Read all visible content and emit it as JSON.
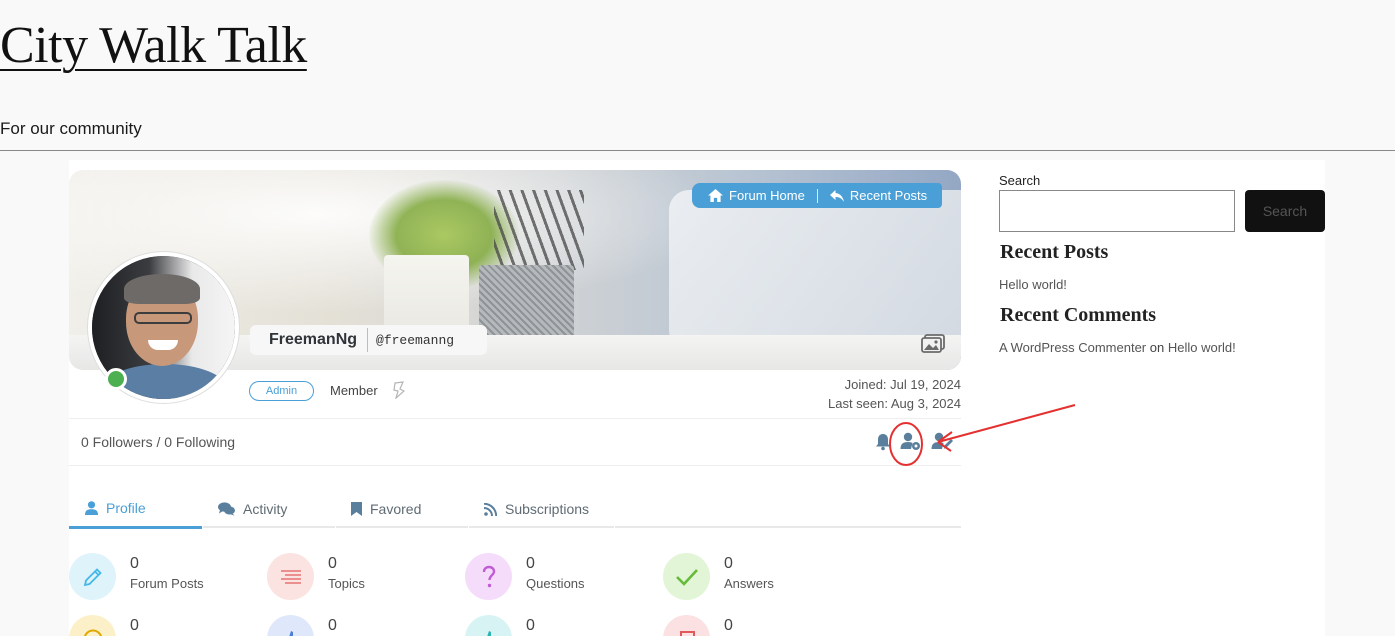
{
  "site": {
    "title": "City Walk Talk",
    "tagline": "For our community"
  },
  "profile": {
    "nav": {
      "forum_home": "Forum Home",
      "recent_posts": "Recent Posts"
    },
    "display_name": "FreemanNg",
    "username": "@freemanng",
    "role_badge": "Admin",
    "rank": "Member",
    "joined": "Joined: Jul 19, 2024",
    "last_seen": "Last seen: Aug 3, 2024",
    "online": true,
    "follow_text": "0 Followers / 0 Following",
    "action_icons": [
      "bell-icon",
      "user-settings-icon",
      "user-edit-icon"
    ],
    "tabs": [
      {
        "label": "Profile",
        "icon": "user-icon",
        "active": true
      },
      {
        "label": "Activity",
        "icon": "comments-icon",
        "active": false
      },
      {
        "label": "Favored",
        "icon": "bookmark-icon",
        "active": false
      },
      {
        "label": "Subscriptions",
        "icon": "rss-icon",
        "active": false
      }
    ],
    "stats": [
      {
        "value": "0",
        "label": "Forum Posts",
        "icon": "pencil-icon",
        "color": "#45b8e8",
        "bg": "#dff3fb"
      },
      {
        "value": "0",
        "label": "Topics",
        "icon": "list-icon",
        "color": "#e57373",
        "bg": "#fbe3e1"
      },
      {
        "value": "0",
        "label": "Questions",
        "icon": "question-icon",
        "color": "#c05cd6",
        "bg": "#f5dcfb"
      },
      {
        "value": "0",
        "label": "Answers",
        "icon": "check-icon",
        "color": "#66bb3a",
        "bg": "#e2f5d6"
      }
    ],
    "stats_row2": [
      {
        "value": "0",
        "icon": "comment-icon",
        "color": "#e0a800",
        "bg": "#fbf0c8"
      },
      {
        "value": "0",
        "icon": "thumbs-up-icon",
        "color": "#4a7fd6",
        "bg": "#dfe8fb"
      },
      {
        "value": "0",
        "icon": "thumbs-up-icon",
        "color": "#2bb3b3",
        "bg": "#d8f3f3"
      },
      {
        "value": "0",
        "icon": "flag-icon",
        "color": "#e05a5a",
        "bg": "#fbe1e1"
      }
    ]
  },
  "sidebar": {
    "search_label": "Search",
    "search_button": "Search",
    "search_value": "",
    "recent_posts_title": "Recent Posts",
    "recent_posts": [
      "Hello world!"
    ],
    "recent_comments_title": "Recent Comments",
    "recent_comment": {
      "author": "A WordPress Commenter",
      "on": "on",
      "post": "Hello world!"
    }
  },
  "colors": {
    "accent": "#4a9fd6",
    "online": "#4caf50",
    "annotation": "#e53030"
  }
}
